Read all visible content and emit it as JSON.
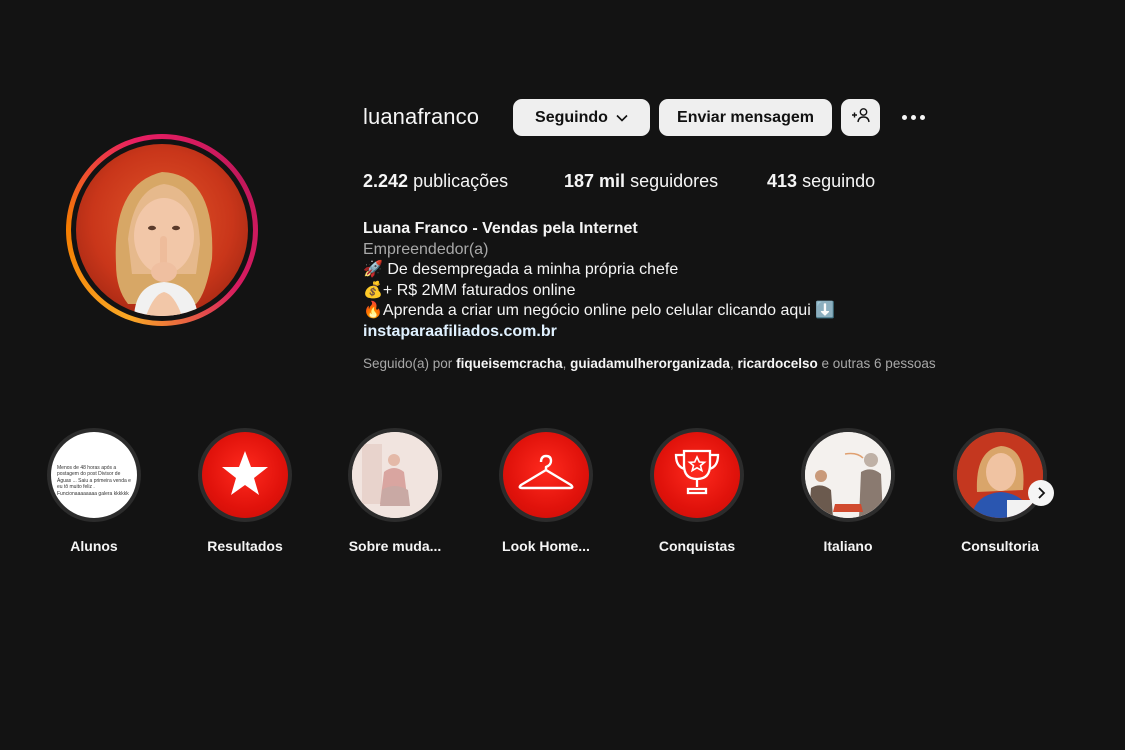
{
  "profile": {
    "username": "luanafranco",
    "follow_button": "Seguindo",
    "message_button": "Enviar mensagem",
    "add_user_icon": "person-plus-icon",
    "more_icon": "ellipsis-icon"
  },
  "stats": {
    "posts_value": "2.242",
    "posts_label": "publicações",
    "followers_value": "187 mil",
    "followers_label": "seguidores",
    "following_value": "413",
    "following_label": "seguindo"
  },
  "bio": {
    "name": "Luana Franco - Vendas pela Internet",
    "category": "Empreendedor(a)",
    "line1": "🚀 De desempregada a minha própria chefe",
    "line2": "💰+ R$ 2MM faturados online",
    "line3": "🔥Aprenda a criar um negócio online pelo celular clicando aqui ⬇️",
    "link": "instaparaafiliados.com.br"
  },
  "followed_by": {
    "prefix": "Seguido(a) por",
    "user1": "fiqueisemcracha",
    "user2": "guiadamulherorganizada",
    "user3": "ricardocelso",
    "suffix": "e outras 6 pessoas"
  },
  "highlights": [
    {
      "label": "Alunos",
      "preview_text": "Menos de 48 horas após a postagem do post Divisor de Águas ... Saiu a primeira venda e eu tô muito feliz . Funcionaaaaaaaa galera kkkkkk"
    },
    {
      "label": "Resultados",
      "icon": "star-icon"
    },
    {
      "label": "Sobre muda...",
      "icon": "photo"
    },
    {
      "label": "Look Home...",
      "icon": "hanger-icon"
    },
    {
      "label": "Conquistas",
      "icon": "trophy-icon"
    },
    {
      "label": "Italiano",
      "icon": "photo"
    },
    {
      "label": "Consultoria",
      "icon": "photo"
    }
  ],
  "colors": {
    "background": "#131313",
    "button": "#efefef",
    "highlight_red": "#e31b14",
    "link": "#e0f1ff"
  }
}
